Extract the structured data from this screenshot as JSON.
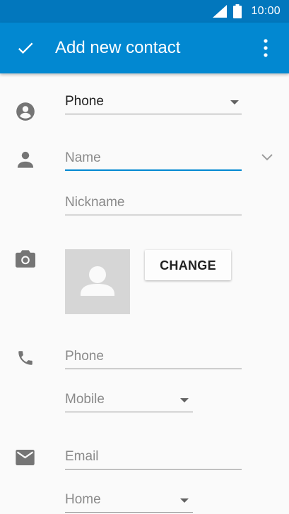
{
  "status_bar": {
    "time": "10:00"
  },
  "app_bar": {
    "title": "Add new contact",
    "confirm_icon": "check-icon",
    "menu_icon": "more-vert-icon"
  },
  "account": {
    "value": "Phone",
    "icon": "account-circle-icon"
  },
  "name_section": {
    "icon": "person-icon",
    "name_placeholder": "Name",
    "nickname_placeholder": "Nickname",
    "expand_icon": "chevron-down-icon"
  },
  "photo_section": {
    "icon": "camera-icon",
    "change_label": "CHANGE"
  },
  "phone_section": {
    "icon": "phone-icon",
    "placeholder": "Phone",
    "type": "Mobile"
  },
  "email_section": {
    "icon": "email-icon",
    "placeholder": "Email",
    "type": "Home"
  },
  "colors": {
    "app_bar": "#0288d1",
    "status_bar": "#0277bd",
    "accent": "#0288d1",
    "icon_gray": "#757575"
  }
}
